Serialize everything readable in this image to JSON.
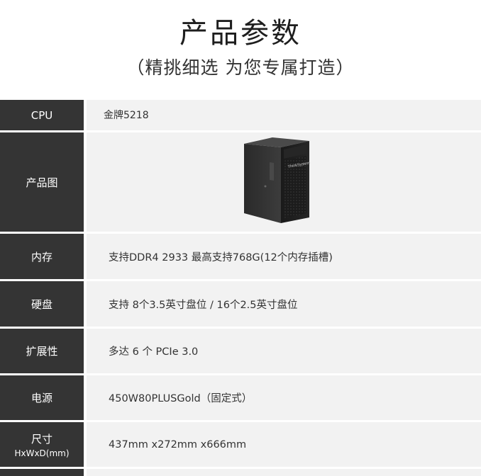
{
  "header": {
    "title": "产品参数",
    "subtitle": "（精挑细选 为您专属打造）"
  },
  "rows": [
    {
      "label": "CPU",
      "value": "金牌5218"
    },
    {
      "label": "产品图",
      "value": ""
    },
    {
      "label": "内存",
      "value": "支持DDR4 2933 最高支持768G(12个内存插槽)"
    },
    {
      "label": "硬盘",
      "value": "支持 8个3.5英寸盘位 / 16个2.5英寸盘位"
    },
    {
      "label": "扩展性",
      "value": "多达 6 个 PCIe 3.0"
    },
    {
      "label": "电源",
      "value": "450W80PLUSGold（固定式）"
    },
    {
      "label": "尺寸",
      "label_sub": "HxWxD(mm)",
      "value": "437mm x272mm x666mm"
    }
  ],
  "product_image": {
    "brand_text": "ThinkSystem",
    "icon": "tower-server-icon"
  },
  "colors": {
    "label_bg": "#343434",
    "value_bg": "#f2f2f2"
  }
}
